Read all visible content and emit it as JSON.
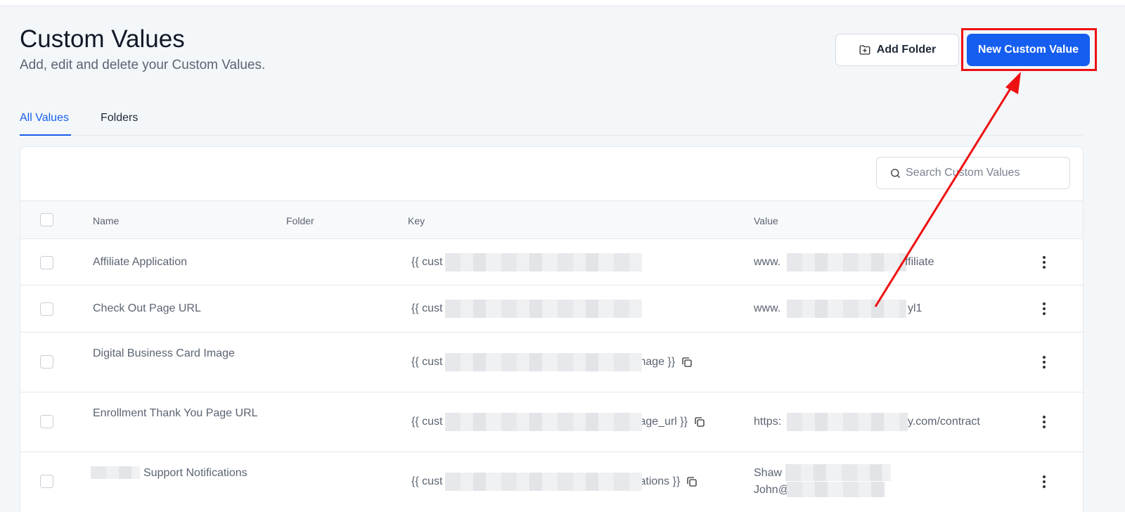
{
  "header": {
    "title": "Custom Values",
    "subtitle": "Add, edit and delete your Custom Values.",
    "add_folder_label": "Add Folder",
    "new_value_label": "New Custom Value"
  },
  "tabs": [
    {
      "label": "All Values",
      "active": true
    },
    {
      "label": "Folders",
      "active": false
    }
  ],
  "search": {
    "placeholder": "Search Custom Values"
  },
  "table": {
    "columns": [
      "Name",
      "Folder",
      "Key",
      "Value"
    ],
    "rows": [
      {
        "name": "Affiliate Application",
        "key_prefix": "{{ cust",
        "key_suffix": "",
        "value_prefix": "www.",
        "value_suffix": "ffiliate"
      },
      {
        "name": "Check Out Page URL",
        "key_prefix": "{{ cust",
        "key_suffix": "",
        "value_prefix": "www.",
        "value_suffix": "yl1"
      },
      {
        "name": "Digital Business Card Image",
        "key_prefix": "{{ cust",
        "key_suffix": "nage }}",
        "value_prefix": "",
        "value_suffix": ""
      },
      {
        "name": "Enrollment Thank You Page URL",
        "key_prefix": "{{ cust",
        "key_suffix": "age_url }}",
        "value_prefix": "https:",
        "value_suffix": "y.com/contract"
      },
      {
        "name": "Support Notifications",
        "key_prefix": "{{ cust",
        "key_suffix": "ations }}",
        "value_prefix": "Shaw",
        "value_line2": "John@"
      }
    ]
  },
  "colors": {
    "accent": "#155eef",
    "annotation": "#ee1111"
  }
}
